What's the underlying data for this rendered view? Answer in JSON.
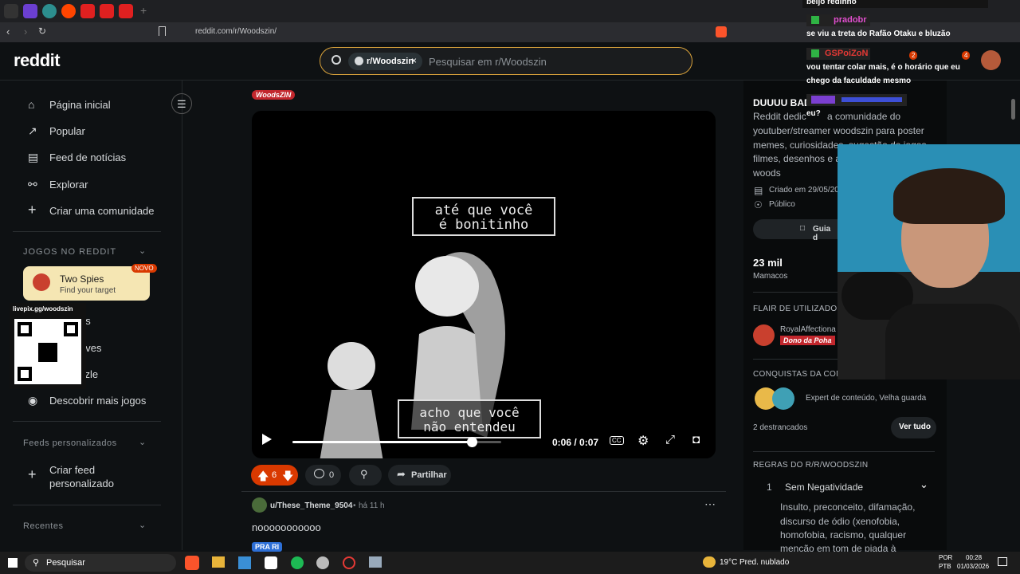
{
  "browser": {
    "url": "reddit.com/r/Woodszin/"
  },
  "header": {
    "logo": "reddit",
    "chip_label": "r/Woodszin",
    "search_placeholder": "Pesquisar em r/Woodszin",
    "badges": [
      "2",
      "4"
    ]
  },
  "leftnav": {
    "items": [
      {
        "label": "Página inicial",
        "icon": "home-icon"
      },
      {
        "label": "Popular",
        "icon": "popular-icon"
      },
      {
        "label": "Feed de notícias",
        "icon": "news-icon"
      },
      {
        "label": "Explorar",
        "icon": "explore-icon"
      },
      {
        "label": "Criar uma comunidade",
        "icon": "plus-icon"
      }
    ],
    "games_section": "JOGOS NO REDDIT",
    "game_card": {
      "title": "Two Spies",
      "subtitle": "Find your target",
      "badge": "NOVO"
    },
    "game_rows_partial": [
      "ds",
      "eves",
      "zzle"
    ],
    "discover_games": "Descobrir mais jogos",
    "feeds_section": "Feeds personalizados",
    "create_feed_line1": "Criar feed",
    "create_feed_line2": "personalizado",
    "recent_section": "Recentes"
  },
  "overlay": {
    "livepix": "livepix.gg/woodszin"
  },
  "post": {
    "flair": "WoodsZIN",
    "video": {
      "caption_top_1": "até que você",
      "caption_top_2": "é bonitinho",
      "caption_bottom_1": "acho que você",
      "caption_bottom_2": "não entendeu",
      "time": "0:06 / 0:07",
      "progress": 0.857
    },
    "votes": "6",
    "comments": "0",
    "share_label": "Partilhar"
  },
  "comment": {
    "user": "u/These_Theme_9504",
    "time": "há 11 h",
    "text": "nooooooooooo",
    "flair": "PRA RI"
  },
  "rightcol": {
    "title": "DUUUU BAD",
    "desc_lines": [
      "Reddit dedic",
      "youtuber/streamer woodszin para poster",
      "memes, curiosidades, sugestão de jogos,",
      "filmes, desenhos e as",
      "woods"
    ],
    "desc_tail": "a comunidade do",
    "created": "Criado em 29/05/20",
    "public": "Público",
    "guide_btn": "Guia d",
    "members": "23 mil",
    "members_label": "Mamacos",
    "flair_section": "FLAIR DE UTILIZADOR",
    "flair_user": "RoyalAffectiona",
    "flair_tag": "Dono da Poha",
    "achievements_section": "CONQUISTAS DA COMU",
    "achievements": "Expert de conteúdo, Velha guarda",
    "unlocked": "2 destrancados",
    "see_all": "Ver tudo",
    "rules_section": "REGRAS DO R/R/WOODSZIN",
    "rule_num": "1",
    "rule_title": "Sem Negatividade",
    "rule_lines": [
      "Insulto, preconceito, difamação,",
      "discurso de ódio (xenofobia,",
      "homofobia, racismo, qualquer",
      "menção em tom de piada à"
    ]
  },
  "chat": {
    "line0": "beijo redinho",
    "user1": "pradobr",
    "msg1": "se viu a treta do Rafão Otaku e bluzão",
    "user2": "GSPoiZoN",
    "msg2a": "vou tentar colar mais, é o horário que eu",
    "msg2b": "chego da faculdade mesmo",
    "msg3": "eu?"
  },
  "taskbar": {
    "search": "Pesquisar",
    "weather_temp": "19°C",
    "weather_text": "Pred. nublado",
    "lang1": "POR",
    "lang2": "PTB",
    "time": "00:28",
    "date": "01/03/2026"
  },
  "colors": {
    "upvote": "#d93900",
    "accent": "#d9a23b"
  }
}
